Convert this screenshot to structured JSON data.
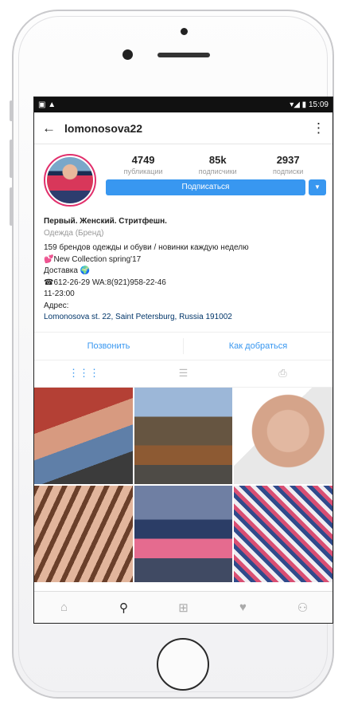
{
  "status": {
    "time": "15:09"
  },
  "topbar": {
    "username": "lomonosova22"
  },
  "stats": [
    {
      "count": "4749",
      "label": "публикации"
    },
    {
      "count": "85k",
      "label": "подписчики"
    },
    {
      "count": "2937",
      "label": "подписки"
    }
  ],
  "follow_label": "Подписаться",
  "bio": {
    "name": "Первый. Женский. Стритфешн.",
    "category": "Одежда (Бренд)",
    "lines": [
      " 159 брендов одежды и обуви / новинки каждую неделю",
      "💕New Collection spring'17",
      "Доставка 🌍",
      "☎612-26-29 WA:8(921)958-22-46",
      "11-23:00",
      "Адрес:"
    ],
    "address": "Lomonosova st. 22, Saint Petersburg, Russia 191002"
  },
  "actions": {
    "call": "Позвонить",
    "directions": "Как добраться"
  },
  "tabs": [
    {
      "icon": "grid-icon",
      "glyph": "⋮⋮⋮"
    },
    {
      "icon": "list-icon",
      "glyph": "☰"
    },
    {
      "icon": "tagged-icon",
      "glyph": "⎙"
    }
  ],
  "bottom_nav": [
    {
      "icon": "home-icon",
      "glyph": "⌂"
    },
    {
      "icon": "search-icon",
      "glyph": "⚲"
    },
    {
      "icon": "add-icon",
      "glyph": "⊞"
    },
    {
      "icon": "heart-icon",
      "glyph": "♥"
    },
    {
      "icon": "profile-icon",
      "glyph": "⚇"
    }
  ],
  "colors": {
    "accent": "#3897f0",
    "story_ring": "#e1306c"
  }
}
